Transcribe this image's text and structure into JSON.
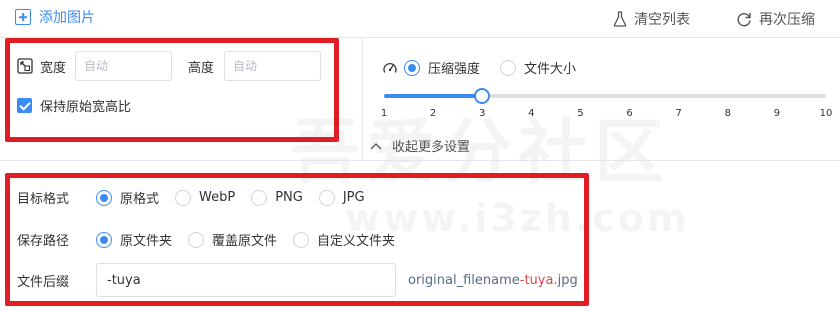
{
  "toolbar": {
    "add_image": "添加图片",
    "clear_list": "清空列表",
    "recompress": "再次压缩"
  },
  "size": {
    "width_label": "宽度",
    "width_placeholder": "自动",
    "height_label": "高度",
    "height_placeholder": "自动",
    "keep_ratio_label": "保持原始宽高比",
    "keep_ratio_checked": true
  },
  "compression": {
    "mode_options": [
      "压缩强度",
      "文件大小"
    ],
    "selected_mode": "压缩强度",
    "slider_min": 1,
    "slider_max": 10,
    "slider_value": 3,
    "ticks": [
      "1",
      "2",
      "3",
      "4",
      "5",
      "6",
      "7",
      "8",
      "9",
      "10"
    ],
    "collapse_label": "收起更多设置"
  },
  "output": {
    "format_label": "目标格式",
    "format_options": [
      "原格式",
      "WebP",
      "PNG",
      "JPG"
    ],
    "selected_format": "原格式",
    "path_label": "保存路径",
    "path_options": [
      "原文件夹",
      "覆盖原文件",
      "自定义文件夹"
    ],
    "selected_path": "原文件夹",
    "suffix_label": "文件后缀",
    "suffix_value": "-tuya",
    "example_prefix": "original_filename",
    "example_suffix": "-tuya",
    "example_ext": ".jpg"
  },
  "watermark": {
    "text": "吾爱分社区",
    "url": "www.i3zh.com"
  },
  "colors": {
    "accent": "#3b8cf0",
    "highlight_box": "#e01d24",
    "example_suffix": "#e0434a"
  }
}
